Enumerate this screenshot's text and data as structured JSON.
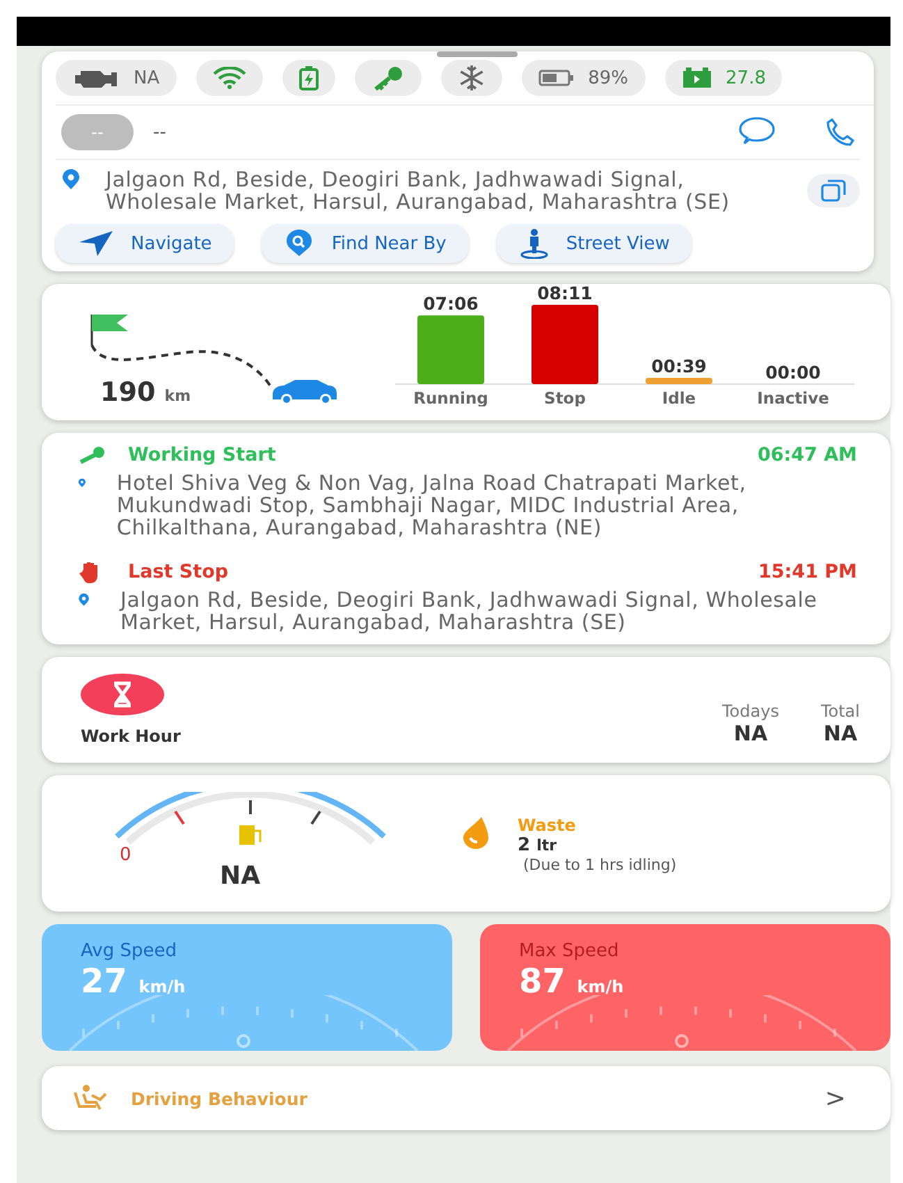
{
  "status_chips": [
    {
      "kind": "engine",
      "text": "NA"
    },
    {
      "kind": "wifi"
    },
    {
      "kind": "charging"
    },
    {
      "kind": "key"
    },
    {
      "kind": "snowflake"
    },
    {
      "kind": "battery",
      "text": "89%"
    },
    {
      "kind": "car-battery",
      "text": "27.8"
    }
  ],
  "driver": {
    "avatar_text": "--",
    "name": "--"
  },
  "location": {
    "address": "Jalgaon Rd, Beside, Deogiri Bank, Jadhwawadi Signal, Wholesale Market, Harsul, Aurangabad, Maharashtra (SE)"
  },
  "actions": [
    {
      "kind": "navigate",
      "label": "Navigate"
    },
    {
      "kind": "find",
      "label": "Find Near By"
    },
    {
      "kind": "street",
      "label": "Street View"
    }
  ],
  "distance": {
    "value": "190",
    "unit": "km"
  },
  "activity": {
    "chart_data": {
      "type": "bar",
      "categories": [
        "Running",
        "Stop",
        "Idle",
        "Inactive"
      ],
      "values": [
        426,
        491,
        39,
        0
      ],
      "value_labels": [
        "07:06",
        "08:11",
        "00:39",
        "00:00"
      ]
    }
  },
  "events": [
    {
      "kind": "start",
      "title": "Working Start",
      "time": "06:47 AM",
      "address": "Hotel Shiva Veg & Non Vag, Jalna Road Chatrapati Market, Mukundwadi Stop, Sambhaji Nagar, MIDC Industrial Area, Chilkalthana, Aurangabad, Maharashtra (NE)"
    },
    {
      "kind": "stop",
      "title": "Last Stop",
      "time": "15:41 PM",
      "address": "Jalgaon Rd, Beside, Deogiri Bank, Jadhwawadi Signal, Wholesale Market, Harsul, Aurangabad, Maharashtra (SE)"
    }
  ],
  "work_hour": {
    "label": "Work Hour",
    "columns": [
      {
        "label": "Todays",
        "value": "NA"
      },
      {
        "label": "Total",
        "value": "NA"
      }
    ]
  },
  "fuel": {
    "gauge_min": "0",
    "value": "NA",
    "waste_label": "Waste",
    "waste_value": "2",
    "waste_unit": "ltr",
    "waste_note": "(Due to 1 hrs idling)"
  },
  "speeds": [
    {
      "kind": "avg",
      "label": "Avg Speed",
      "value": "27",
      "unit": "km/h"
    },
    {
      "kind": "max",
      "label": "Max Speed",
      "value": "87",
      "unit": "km/h"
    }
  ],
  "driving_behaviour": {
    "label": "Driving Behaviour",
    "chevron": ">"
  }
}
